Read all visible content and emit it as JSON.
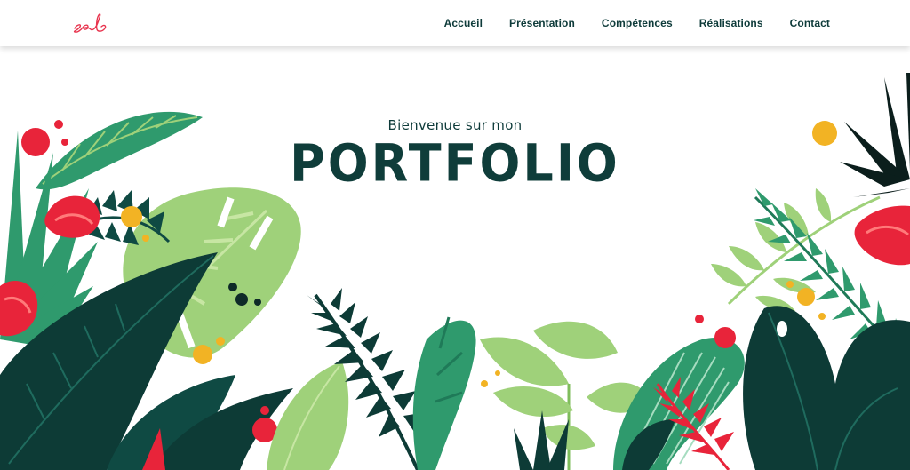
{
  "header": {
    "logo_text": "seb",
    "nav": [
      {
        "label": "Accueil"
      },
      {
        "label": "Présentation"
      },
      {
        "label": "Compétences"
      },
      {
        "label": "Réalisations"
      },
      {
        "label": "Contact"
      }
    ]
  },
  "hero": {
    "subtitle": "Bienvenue sur mon",
    "title": "PORTFOLIO"
  },
  "colors": {
    "text_dark": "#0e3b3a",
    "logo_red": "#e8344e",
    "leaf_dark": "#0f4a43",
    "leaf_green": "#2f9a6d",
    "leaf_light": "#9fd17a",
    "berry_red": "#e8243a",
    "berry_yellow": "#f2b324"
  }
}
